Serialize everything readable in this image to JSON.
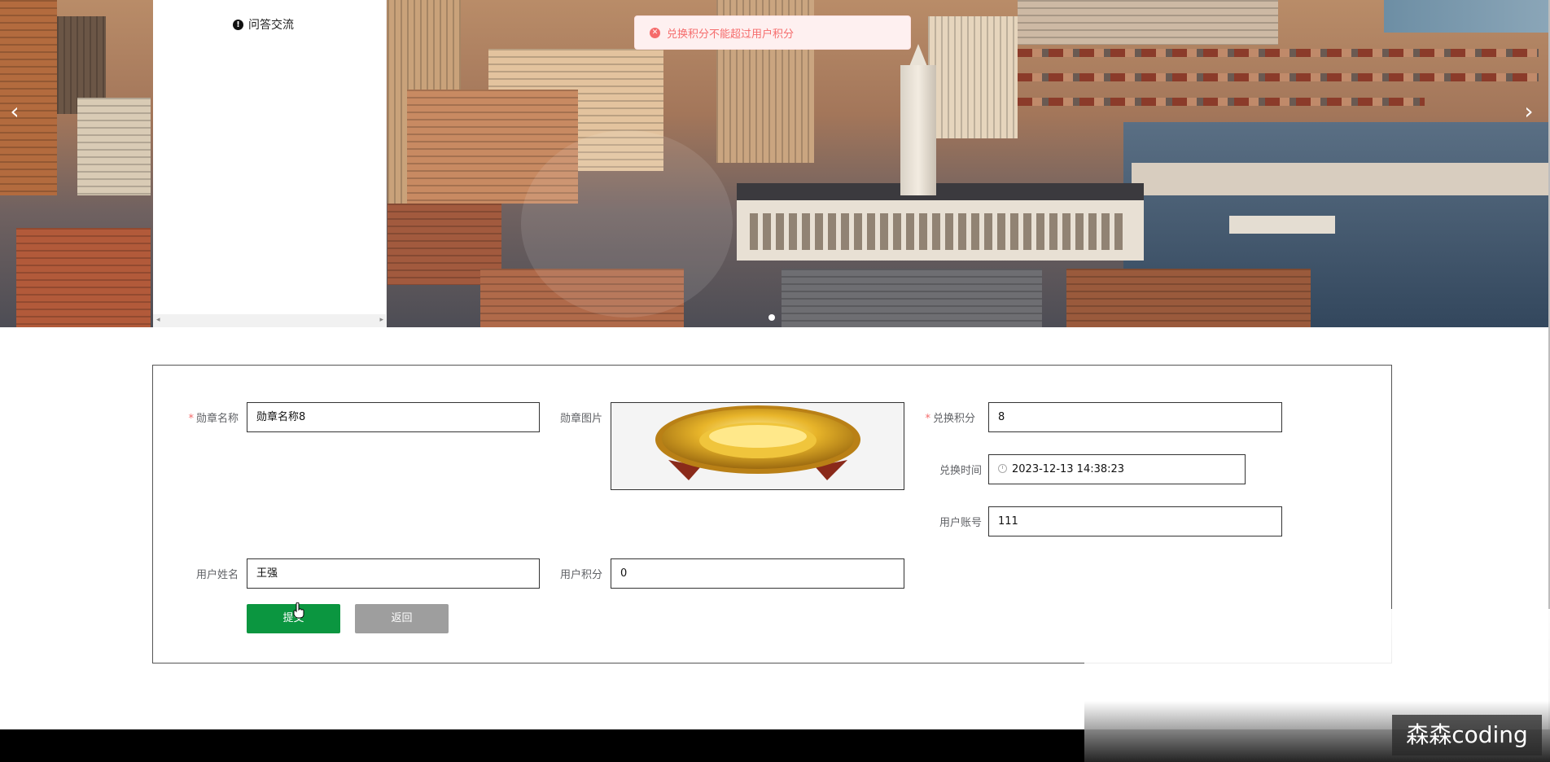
{
  "banner": {
    "prev_arrow": "‹",
    "next_arrow": "›"
  },
  "menu": {
    "item_label": "问答交流",
    "scroll_left": "◂",
    "scroll_right": "▸"
  },
  "toast": {
    "message": "兑换积分不能超过用户积分"
  },
  "form": {
    "medal_name": {
      "label": "勋章名称",
      "value": "勋章名称8",
      "required": true
    },
    "medal_image": {
      "label": "勋章图片"
    },
    "points": {
      "label": "兑换积分",
      "value": "8",
      "required": true
    },
    "exchange_time": {
      "label": "兑换时间",
      "value": "2023-12-13 14:38:23"
    },
    "user_account": {
      "label": "用户账号",
      "value": "111"
    },
    "user_name": {
      "label": "用户姓名",
      "value": "王强"
    },
    "user_points": {
      "label": "用户积分",
      "value": "0"
    },
    "submit_label": "提交",
    "back_label": "返回"
  },
  "watermark_brand": "森森coding"
}
